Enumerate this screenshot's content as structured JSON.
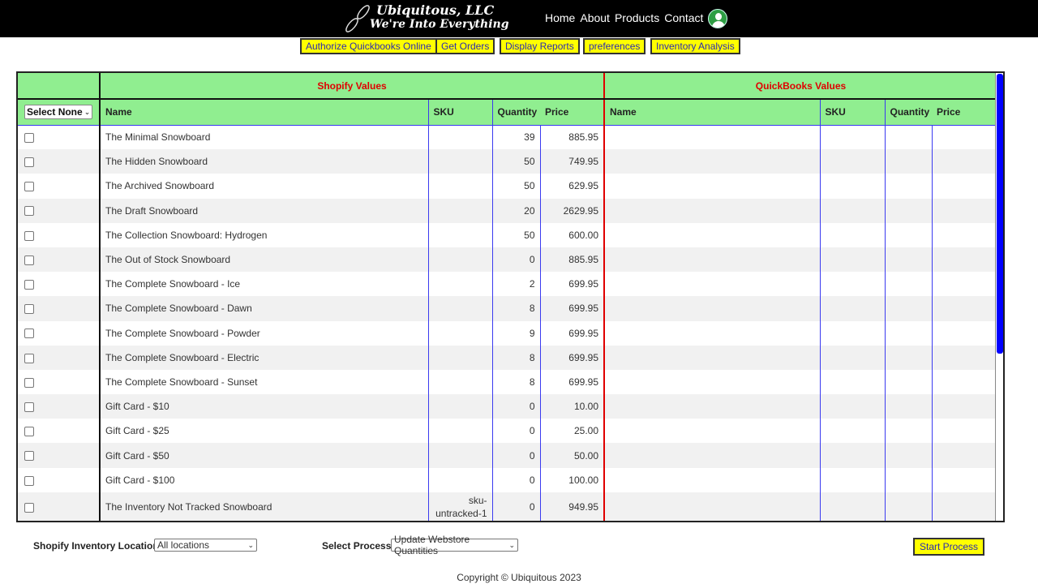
{
  "header": {
    "logo_line1": "Ubiquitous, LLC",
    "logo_line2": "We're Into Everything",
    "nav": [
      "Home",
      "About",
      "Products",
      "Contact"
    ],
    "user_icon": "user-avatar-icon"
  },
  "toolbar": {
    "buttons": [
      "Authorize Quickbooks Online",
      "Get Orders",
      "Display Reports",
      "preferences",
      "Inventory Analysis"
    ]
  },
  "table": {
    "group_headers": {
      "shopify": "Shopify Values",
      "quickbooks": "QuickBooks Values"
    },
    "select_label": "Select None",
    "columns": {
      "shopify": [
        "Name",
        "SKU",
        "Quantity",
        "Price"
      ],
      "quickbooks": [
        "Name",
        "SKU",
        "Quantity",
        "Price"
      ]
    },
    "rows": [
      {
        "name": "The Minimal Snowboard",
        "sku": "",
        "qty": "39",
        "price": "885.95"
      },
      {
        "name": "The Hidden Snowboard",
        "sku": "",
        "qty": "50",
        "price": "749.95"
      },
      {
        "name": "The Archived Snowboard",
        "sku": "",
        "qty": "50",
        "price": "629.95"
      },
      {
        "name": "The Draft Snowboard",
        "sku": "",
        "qty": "20",
        "price": "2629.95"
      },
      {
        "name": "The Collection Snowboard: Hydrogen",
        "sku": "",
        "qty": "50",
        "price": "600.00"
      },
      {
        "name": "The Out of Stock Snowboard",
        "sku": "",
        "qty": "0",
        "price": "885.95"
      },
      {
        "name": "The Complete Snowboard - Ice",
        "sku": "",
        "qty": "2",
        "price": "699.95"
      },
      {
        "name": "The Complete Snowboard - Dawn",
        "sku": "",
        "qty": "8",
        "price": "699.95"
      },
      {
        "name": "The Complete Snowboard - Powder",
        "sku": "",
        "qty": "9",
        "price": "699.95"
      },
      {
        "name": "The Complete Snowboard - Electric",
        "sku": "",
        "qty": "8",
        "price": "699.95"
      },
      {
        "name": "The Complete Snowboard - Sunset",
        "sku": "",
        "qty": "8",
        "price": "699.95"
      },
      {
        "name": "Gift Card - $10",
        "sku": "",
        "qty": "0",
        "price": "10.00"
      },
      {
        "name": "Gift Card - $25",
        "sku": "",
        "qty": "0",
        "price": "25.00"
      },
      {
        "name": "Gift Card - $50",
        "sku": "",
        "qty": "0",
        "price": "50.00"
      },
      {
        "name": "Gift Card - $100",
        "sku": "",
        "qty": "0",
        "price": "100.00"
      },
      {
        "name": "The Inventory Not Tracked Snowboard",
        "sku": "sku-untracked-1",
        "qty": "0",
        "price": "949.95"
      }
    ]
  },
  "bottom": {
    "location_label": "Shopify Inventory Location:",
    "location_value": "All locations",
    "process_label": "Select Process:",
    "process_value": "Update Webstore Quantities",
    "start_label": "Start Process"
  },
  "footer": {
    "copyright": "Copyright © Ubiquitous 2023"
  }
}
